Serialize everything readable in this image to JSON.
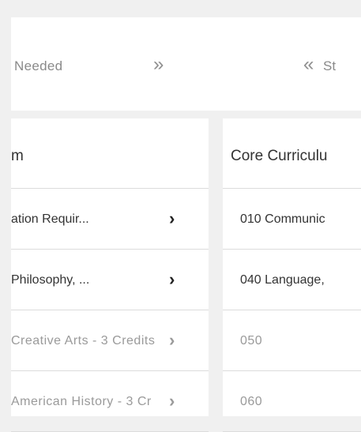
{
  "nav": {
    "left_label": "Needed",
    "right_label": "St"
  },
  "left_panel": {
    "header": "m",
    "rows": [
      {
        "label": "ation Requir...",
        "faded": false
      },
      {
        "label": "Philosophy, ...",
        "faded": false
      },
      {
        "label": "Creative Arts - 3 Credits",
        "faded": true
      },
      {
        "label": "American History - 3 Cr",
        "faded": true
      }
    ]
  },
  "right_panel": {
    "header": "Core Curriculu",
    "rows": [
      {
        "label": "010 Communic"
      },
      {
        "label": "040 Language,"
      },
      {
        "label": "050"
      },
      {
        "label": "060"
      }
    ]
  }
}
